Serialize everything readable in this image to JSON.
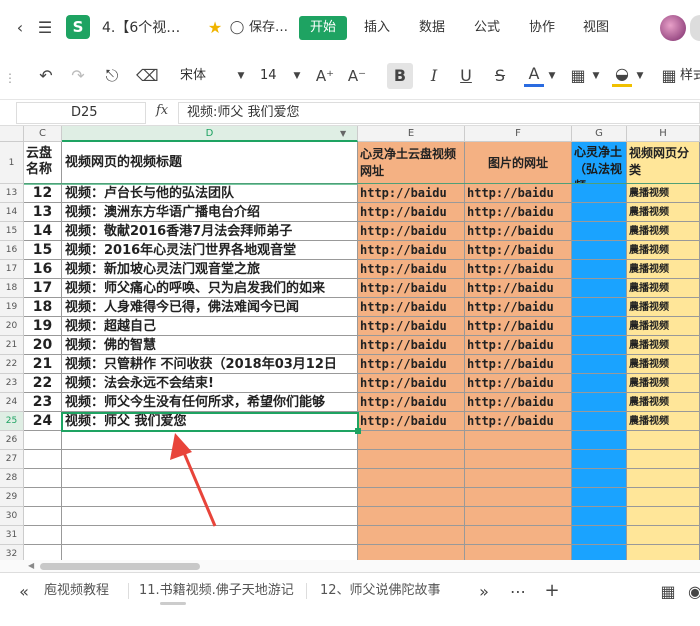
{
  "window": {
    "title": "4.【6个视…",
    "save_status": "保存…",
    "zoom_hint": ""
  },
  "menu": {
    "items": [
      "开始",
      "插入",
      "数据",
      "公式",
      "协作",
      "视图"
    ]
  },
  "toolbar": {
    "font_name": "宋体",
    "font_size": "14",
    "style_label": "样式"
  },
  "formula": {
    "cell_ref": "D25",
    "fx": "fx",
    "content": "视频:师父 我们爱您"
  },
  "columns": {
    "headers": [
      "C",
      "D",
      "E",
      "F",
      "G",
      "H"
    ],
    "row1": [
      "云盘名称",
      "视频网页的视频标题",
      "心灵净土云盘视频网址",
      "图片的网址",
      "心灵净土（弘法视频",
      "视频网页分类"
    ]
  },
  "rows": [
    {
      "n": "13",
      "num": "12",
      "title": "视频：卢台长与他的弘法团队",
      "e": "http://baidu",
      "f": "http://baidu",
      "h": "農播视频"
    },
    {
      "n": "14",
      "num": "13",
      "title": "视频：澳洲东方华语广播电台介绍",
      "e": "http://baidu",
      "f": "http://baidu",
      "h": "農播视频"
    },
    {
      "n": "15",
      "num": "14",
      "title": "视频：敬献2016香港7月法会拜师弟子",
      "e": "http://baidu",
      "f": "http://baidu",
      "h": "農播视频"
    },
    {
      "n": "16",
      "num": "15",
      "title": "视频：2016年心灵法门世界各地观音堂",
      "e": "http://baidu",
      "f": "http://baidu",
      "h": "農播视频"
    },
    {
      "n": "17",
      "num": "16",
      "title": "视频：新加坡心灵法门观音堂之旅",
      "e": "http://baidu",
      "f": "http://baidu",
      "h": "農播视频"
    },
    {
      "n": "18",
      "num": "17",
      "title": "视频：师父痛心的呼唤、只为启发我们的如来",
      "e": "http://baidu",
      "f": "http://baidu",
      "h": "農播视频"
    },
    {
      "n": "19",
      "num": "18",
      "title": "视频：人身难得今已得，佛法难闻今已闻",
      "e": "http://baidu",
      "f": "http://baidu",
      "h": "農播视频"
    },
    {
      "n": "20",
      "num": "19",
      "title": "视频：超越自己",
      "e": "http://baidu",
      "f": "http://baidu",
      "h": "農播视频"
    },
    {
      "n": "21",
      "num": "20",
      "title": "视频：佛的智慧",
      "e": "http://baidu",
      "f": "http://baidu",
      "h": "農播视频"
    },
    {
      "n": "22",
      "num": "21",
      "title": "视频：只管耕作 不问收获（2018年03月12日",
      "e": "http://baidu",
      "f": "http://baidu",
      "h": "農播视频"
    },
    {
      "n": "23",
      "num": "22",
      "title": "视频：法会永远不会结束!",
      "e": "http://baidu",
      "f": "http://baidu",
      "h": "農播视频"
    },
    {
      "n": "24",
      "num": "23",
      "title": "视频：师父今生没有任何所求，希望你们能够",
      "e": "http://baidu",
      "f": "http://baidu",
      "h": "農播视频"
    },
    {
      "n": "25",
      "num": "24",
      "title": "视频：师父 我们爱您",
      "e": "http://baidu",
      "f": "http://baidu",
      "h": "農播视频"
    }
  ],
  "empty_rows": [
    "26",
    "27",
    "28",
    "29",
    "30",
    "31",
    "32"
  ],
  "sheet_tabs": [
    "庖视频教程",
    "11.书籍视频.佛子天地游记",
    "12、师父说佛陀故事"
  ],
  "colors": {
    "accent": "#1ea362",
    "orange": "#f4b183",
    "blue": "#1aa3ff",
    "yellow": "#ffe699",
    "arrow": "#e8443a"
  }
}
